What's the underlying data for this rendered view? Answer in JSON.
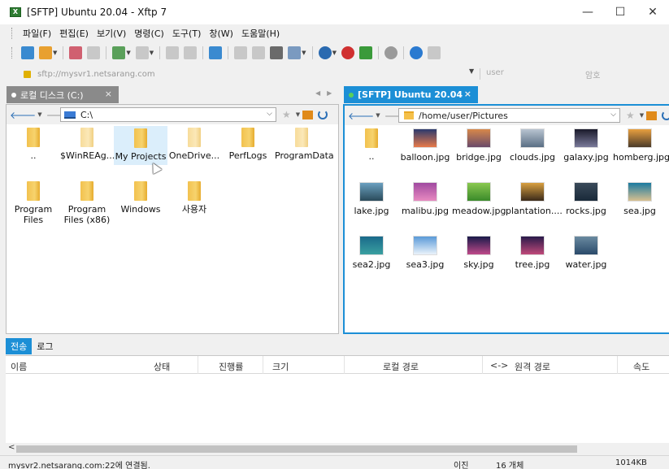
{
  "window": {
    "title": "[SFTP] Ubuntu 20.04 - Xftp 7",
    "logo_text": "X",
    "minimize": "—",
    "maximize": "☐",
    "close": "✕"
  },
  "menu": [
    "파일(F)",
    "편집(E)",
    "보기(V)",
    "명령(C)",
    "도구(T)",
    "창(W)",
    "도움말(H)"
  ],
  "address": {
    "url": "sftp://mysvr1.netsarang.com",
    "user_placeholder": "user",
    "password_placeholder": "암호"
  },
  "left_tab": {
    "label": "로컬 디스크 (C:)",
    "close": "×"
  },
  "right_tab": {
    "label": "[SFTP] Ubuntu 20.04",
    "close": "×"
  },
  "left_path": "C:\\",
  "right_path": "/home/user/Pictures",
  "left_items": [
    {
      "label": "..",
      "light": false
    },
    {
      "label": "$WinREAg...",
      "light": true
    },
    {
      "label": "My Projects",
      "light": false,
      "selected": true
    },
    {
      "label": "OneDrive...",
      "light": true
    },
    {
      "label": "PerfLogs",
      "light": false
    },
    {
      "label": "ProgramData",
      "light": true
    },
    {
      "label": "Program Files",
      "light": false
    },
    {
      "label": "Program Files (x86)",
      "light": false
    },
    {
      "label": "Windows",
      "light": false
    },
    {
      "label": "사용자",
      "light": false
    }
  ],
  "right_items": [
    {
      "label": "..",
      "kind": "folder"
    },
    {
      "label": "balloon.jpg",
      "c1": "#2b3a6e",
      "c2": "#e87a4a"
    },
    {
      "label": "bridge.jpg",
      "c1": "#d8884a",
      "c2": "#6a4a6a"
    },
    {
      "label": "clouds.jpg",
      "c1": "#b8c4d0",
      "c2": "#5a6e84"
    },
    {
      "label": "galaxy.jpg",
      "c1": "#1a1a2a",
      "c2": "#7a7a9a"
    },
    {
      "label": "homberg.jpg",
      "c1": "#e8a040",
      "c2": "#4a3a2a"
    },
    {
      "label": "lake.jpg",
      "c1": "#6aa0c0",
      "c2": "#2a4a5a"
    },
    {
      "label": "malibu.jpg",
      "c1": "#a04aa0",
      "c2": "#e88ac0"
    },
    {
      "label": "meadow.jpg",
      "c1": "#8ac850",
      "c2": "#3a8a2a"
    },
    {
      "label": "plantation....",
      "c1": "#d8a040",
      "c2": "#3a2a1a"
    },
    {
      "label": "rocks.jpg",
      "c1": "#3a4a5a",
      "c2": "#1a2a3a"
    },
    {
      "label": "sea.jpg",
      "c1": "#1a7aa0",
      "c2": "#d8c090"
    },
    {
      "label": "sea2.jpg",
      "c1": "#1a6a8a",
      "c2": "#3aa0a0"
    },
    {
      "label": "sea3.jpg",
      "c1": "#5a9ad8",
      "c2": "#eaf2fa"
    },
    {
      "label": "sky.jpg",
      "c1": "#1a1a4a",
      "c2": "#c04a8a"
    },
    {
      "label": "tree.jpg",
      "c1": "#2a1a4a",
      "c2": "#c04a7a"
    },
    {
      "label": "water.jpg",
      "c1": "#6a8aa0",
      "c2": "#2a4a6a"
    }
  ],
  "bottom_tabs": [
    "전송",
    "로그"
  ],
  "transfer_columns": [
    "이름",
    "상태",
    "진행률",
    "크기",
    "로컬 경로",
    "<->",
    "원격 경로",
    "속도"
  ],
  "status": {
    "connection": "mysvr2.netsarang.com:22에 연결됨.",
    "mode": "이진",
    "count": "16 개체",
    "size": "1014KB"
  },
  "colors": {
    "accent": "#1c8fd6",
    "folder": "#f2c14e"
  }
}
